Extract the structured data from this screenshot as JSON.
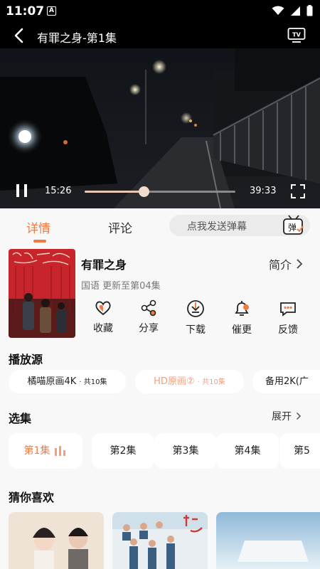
{
  "status_bar": {
    "time": "11:07",
    "notif_badge": "A"
  },
  "header": {
    "title": "有罪之身-第1集"
  },
  "player": {
    "current_time": "15:26",
    "total_time": "39:33",
    "progress": 0.391
  },
  "tabs": {
    "detail": "详情",
    "comments": "评论"
  },
  "danmaku": {
    "placeholder": "点我发送弹幕",
    "icon_char": "弹"
  },
  "show": {
    "title": "有罪之身",
    "intro_label": "简介",
    "meta": "国语 更新至第04集"
  },
  "actions": [
    {
      "label": "收藏",
      "icon": "heart-icon"
    },
    {
      "label": "分享",
      "icon": "share-icon"
    },
    {
      "label": "下载",
      "icon": "download-icon"
    },
    {
      "label": "催更",
      "icon": "bell-icon"
    },
    {
      "label": "反馈",
      "icon": "feedback-icon"
    }
  ],
  "sources": {
    "title": "播放源",
    "items": [
      {
        "name": "橘喵原画4K",
        "count": "· 共10集"
      },
      {
        "name": "HD原画②",
        "count": "· 共10集"
      },
      {
        "name": "备用2K(广"
      }
    ]
  },
  "episodes": {
    "title": "选集",
    "expand_label": "展开",
    "items": [
      "第1集",
      "第2集",
      "第3集",
      "第4集",
      "第5"
    ]
  },
  "recommend": {
    "title": "猜你喜欢"
  },
  "colors": {
    "accent": "#ef7b44",
    "accent_light": "#f2a07c"
  }
}
